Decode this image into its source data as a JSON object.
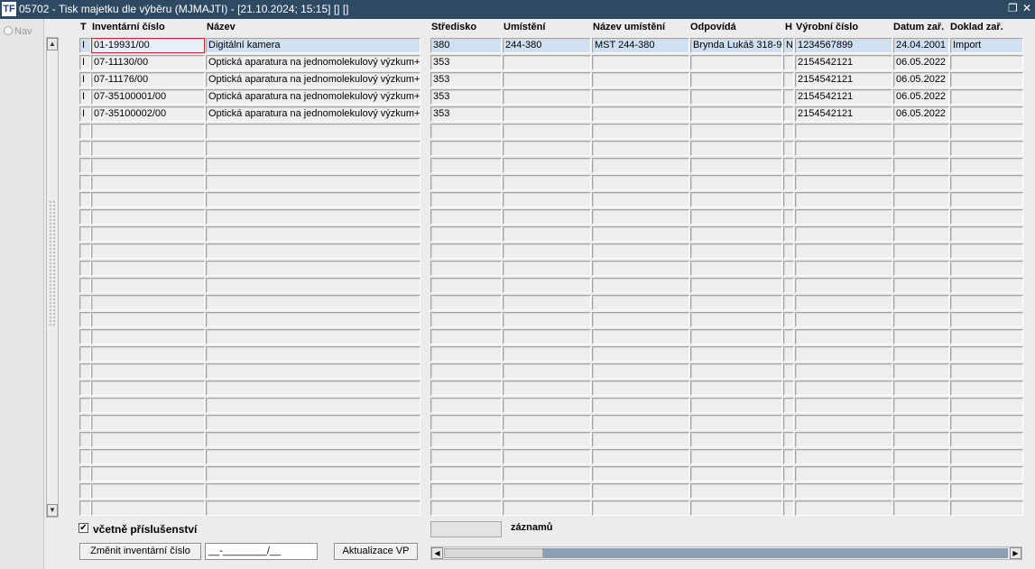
{
  "window": {
    "app_icon": "TF",
    "title": "05702 - Tisk majetku dle výběru (MJMAJTI) - [21.10.2024; 15:15]  [] []",
    "restore_icon": "restore-window-icon",
    "close_icon": "close-icon"
  },
  "nav": {
    "label": "Nav"
  },
  "columns": {
    "t": "T",
    "inv": "Inventární číslo",
    "name": "Název",
    "center": "Středisko",
    "loc": "Umístění",
    "locname": "Název umístění",
    "resp": "Odpovídá",
    "h": "H",
    "serial": "Výrobní číslo",
    "date": "Datum zař.",
    "doc": "Doklad zař."
  },
  "rows": [
    {
      "t": "I",
      "inv": "01-19931/00",
      "name": "Digitální kamera",
      "center": "380",
      "loc": "244-380",
      "locname": "MST 244-380",
      "resp": "Brynda Lukáš 318-9",
      "h": "N",
      "serial": "1234567899",
      "date": "24.04.2001",
      "doc": "Import"
    },
    {
      "t": "I",
      "inv": "07-11130/00",
      "name": "Optická aparatura na jednomolekulový výzkum+ří",
      "center": "353",
      "loc": "",
      "locname": "",
      "resp": "",
      "h": "",
      "serial": "2154542121",
      "date": "06.05.2022",
      "doc": ""
    },
    {
      "t": "I",
      "inv": "07-11176/00",
      "name": "Optická aparatura na jednomolekulový výzkum+ří",
      "center": "353",
      "loc": "",
      "locname": "",
      "resp": "",
      "h": "",
      "serial": "2154542121",
      "date": "06.05.2022",
      "doc": ""
    },
    {
      "t": "I",
      "inv": "07-35100001/00",
      "name": "Optická aparatura na jednomolekulový výzkum+ří",
      "center": "353",
      "loc": "",
      "locname": "",
      "resp": "",
      "h": "",
      "serial": "2154542121",
      "date": "06.05.2022",
      "doc": ""
    },
    {
      "t": "I",
      "inv": "07-35100002/00",
      "name": "Optická aparatura na jednomolekulový výzkum+ří",
      "center": "353",
      "loc": "",
      "locname": "",
      "resp": "",
      "h": "",
      "serial": "2154542121",
      "date": "06.05.2022",
      "doc": ""
    }
  ],
  "bottom": {
    "include_accessories_checked": true,
    "include_accessories_label": "včetně příslušenství",
    "records_count": "",
    "records_label": "záznamů",
    "change_inv_button": "Změnit inventární číslo",
    "inv_field_value": "__-________/__",
    "update_vp_button": "Aktualizace VP"
  }
}
